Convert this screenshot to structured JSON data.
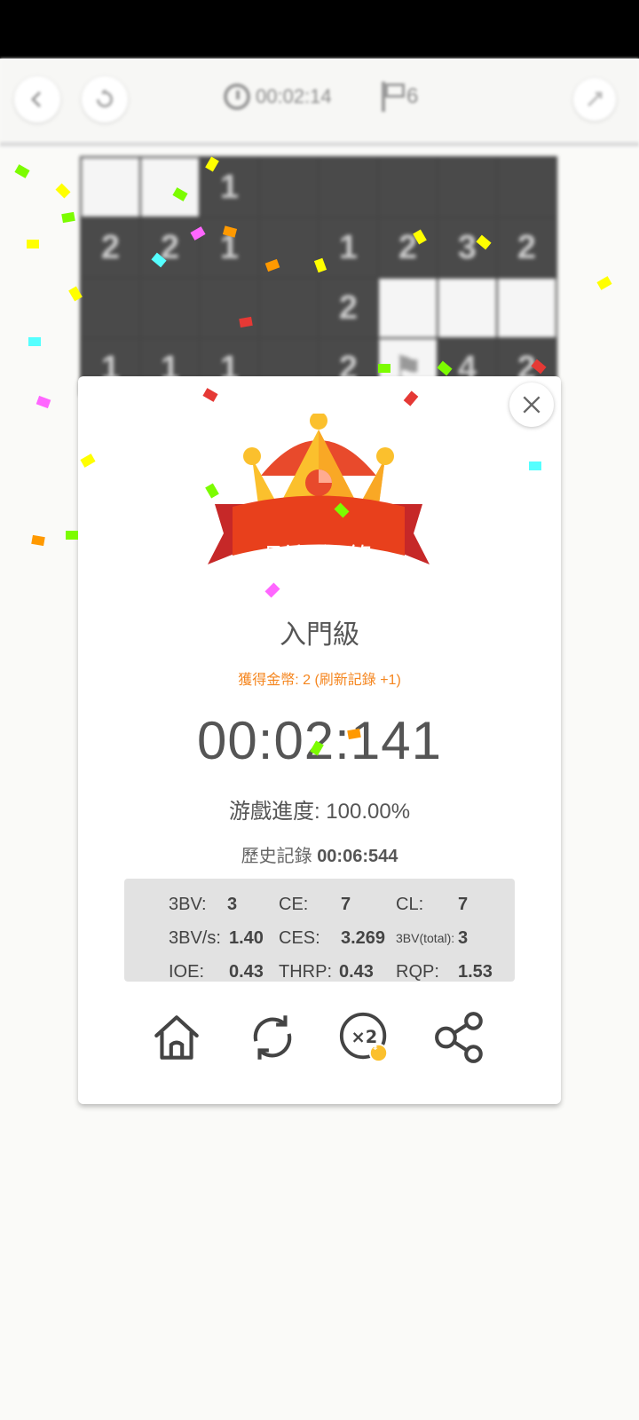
{
  "topbar": {
    "back_icon": "chevron-left-icon",
    "restart_icon": "restart-icon",
    "timer": "00:02:14",
    "flags": "6",
    "settings_icon": "settings-icon"
  },
  "board": {
    "rows": [
      [
        "",
        "",
        "1",
        "",
        "",
        "",
        "",
        ""
      ],
      [
        "2",
        "2",
        "1",
        "",
        "1",
        "2",
        "3",
        "2"
      ],
      [
        "",
        "",
        "",
        "",
        "2",
        "",
        "",
        ""
      ],
      [
        "1",
        "1",
        "1",
        "",
        "2",
        "⚑",
        "4",
        "2"
      ]
    ],
    "open_cells": [
      [
        0,
        0
      ],
      [
        0,
        1
      ],
      [
        2,
        5
      ],
      [
        2,
        6
      ],
      [
        2,
        7
      ],
      [
        3,
        5
      ]
    ]
  },
  "dialog": {
    "banner": "刷新記錄",
    "level": "入門級",
    "coins": "獲得金幣: 2 (刷新記錄 +1)",
    "time": "00:02:141",
    "progress_label": "游戲進度:",
    "progress_value": "100.00%",
    "history_label": "歷史記錄",
    "history_value": "00:06:544",
    "stats": [
      {
        "label": "3BV:",
        "value": "3"
      },
      {
        "label": "CE:",
        "value": "7"
      },
      {
        "label": "CL:",
        "value": "7"
      },
      {
        "label": "3BV/s:",
        "value": "1.40"
      },
      {
        "label": "CES:",
        "value": "3.269"
      },
      {
        "label": "3BV(total):",
        "value": "3"
      },
      {
        "label": "IOE:",
        "value": "0.43"
      },
      {
        "label": "THRP:",
        "value": "0.43"
      },
      {
        "label": "RQP:",
        "value": "1.53"
      }
    ],
    "actions": [
      "home-icon",
      "restart-icon",
      "double-coins-icon",
      "share-icon"
    ],
    "coin_badge": "¥"
  },
  "colors": {
    "accent_orange": "#f5861f",
    "banner_red": "#e8401c",
    "crown_yellow": "#fbc02d"
  }
}
